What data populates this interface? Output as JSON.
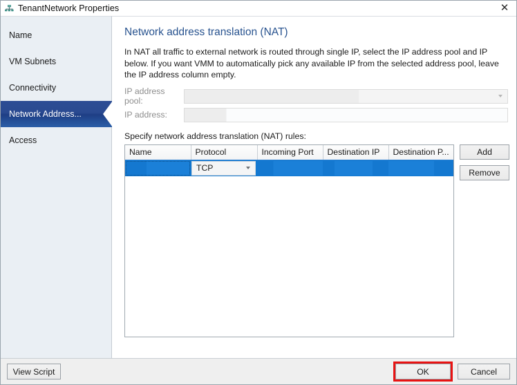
{
  "window": {
    "title": "TenantNetwork Properties",
    "icon": "network-icon",
    "close_label": "✕"
  },
  "sidebar": {
    "items": [
      {
        "label": "Name",
        "selected": false
      },
      {
        "label": "VM Subnets",
        "selected": false
      },
      {
        "label": "Connectivity",
        "selected": false
      },
      {
        "label": "Network Address...",
        "selected": true
      },
      {
        "label": "Access",
        "selected": false
      }
    ]
  },
  "content": {
    "heading": "Network address translation (NAT)",
    "description": "In NAT all traffic to external network is routed through single IP, select the IP address pool and IP below. If you want VMM to automatically pick any available IP from the selected address pool, leave the IP address column empty.",
    "fields": {
      "ip_pool_label": "IP address pool:",
      "ip_pool_value": "",
      "ip_address_label": "IP address:",
      "ip_address_value": ""
    },
    "rules_label": "Specify network address translation (NAT) rules:",
    "table": {
      "columns": [
        "Name",
        "Protocol",
        "Incoming Port",
        "Destination IP",
        "Destination P..."
      ],
      "rows": [
        {
          "name": "",
          "protocol": "TCP",
          "incoming_port": "",
          "destination_ip": "",
          "destination_port": "",
          "selected": true
        }
      ]
    },
    "buttons": {
      "add": "Add",
      "remove": "Remove"
    }
  },
  "footer": {
    "view_script": "View Script",
    "ok": "OK",
    "cancel": "Cancel"
  },
  "colors": {
    "selection_blue": "#1279d2",
    "heading_blue": "#28538f",
    "sidebar_selected_blue": "#2a4a91",
    "highlight_red": "#e81313"
  }
}
